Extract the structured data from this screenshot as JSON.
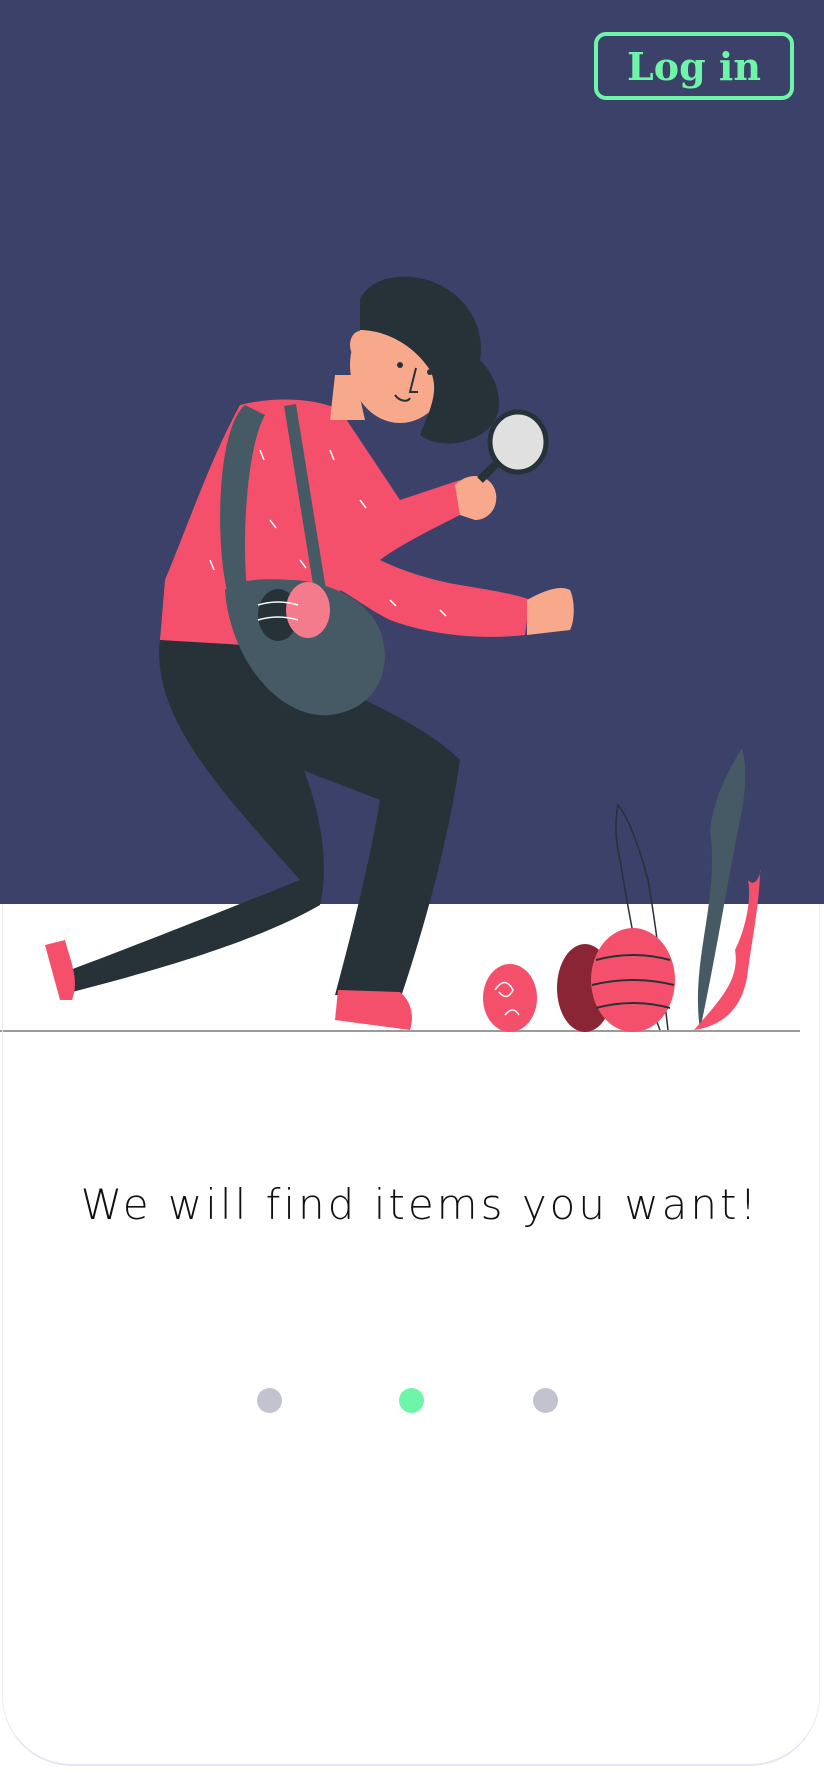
{
  "header": {
    "login_label": "Log in"
  },
  "onboarding": {
    "headline": "We will find items you want!",
    "page_indicator": {
      "total": 3,
      "active_index": 1
    }
  },
  "colors": {
    "hero_background": "#3b4168",
    "accent_green": "#6ff5a8",
    "dot_inactive": "#c3c3cf",
    "sweater_red": "#f4506b",
    "pants_dark": "#263238",
    "bag_gray": "#455a64",
    "skin": "#f9a98b"
  },
  "illustration": {
    "name": "person-searching-eggs-illustration"
  }
}
